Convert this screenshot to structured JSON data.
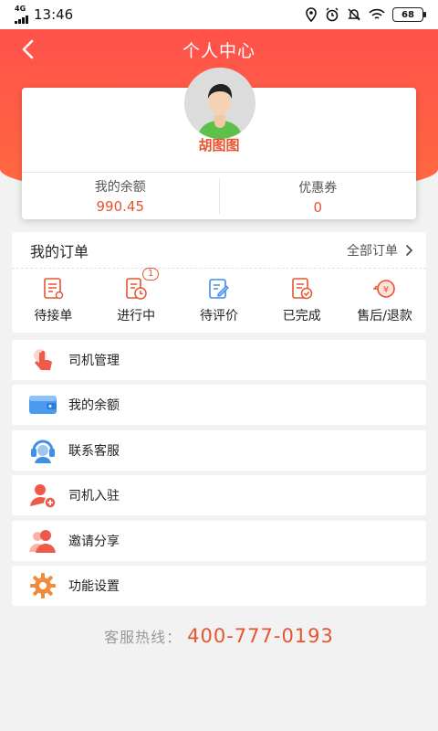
{
  "status_bar": {
    "network": "4G",
    "time": "13:46",
    "battery": "68"
  },
  "nav": {
    "title": "个人中心",
    "back_icon": "back-arrow-icon"
  },
  "profile": {
    "name": "胡图图",
    "balance_label": "我的余额",
    "balance_value": "990.45",
    "coupon_label": "优惠券",
    "coupon_value": "0"
  },
  "orders": {
    "title": "我的订单",
    "all_label": "全部订单",
    "items": [
      {
        "label": "待接单",
        "icon": "pending-order-icon"
      },
      {
        "label": "进行中",
        "icon": "in-progress-icon",
        "badge": "1"
      },
      {
        "label": "待评价",
        "icon": "review-icon"
      },
      {
        "label": "已完成",
        "icon": "completed-icon"
      },
      {
        "label": "售后/退款",
        "icon": "refund-icon"
      }
    ]
  },
  "menu": [
    {
      "label": "司机管理",
      "icon": "hand-pointer-icon"
    },
    {
      "label": "我的余额",
      "icon": "wallet-icon"
    },
    {
      "label": "联系客服",
      "icon": "headset-icon"
    },
    {
      "label": "司机入驻",
      "icon": "add-driver-icon"
    },
    {
      "label": "邀请分享",
      "icon": "share-users-icon"
    },
    {
      "label": "功能设置",
      "icon": "gear-icon"
    }
  ],
  "hotline": {
    "label": "客服热线：",
    "number": "400-777-0193"
  },
  "colors": {
    "accent": "#e8542f",
    "header_top": "#ff4d4d",
    "header_bottom": "#ff6a3f"
  }
}
